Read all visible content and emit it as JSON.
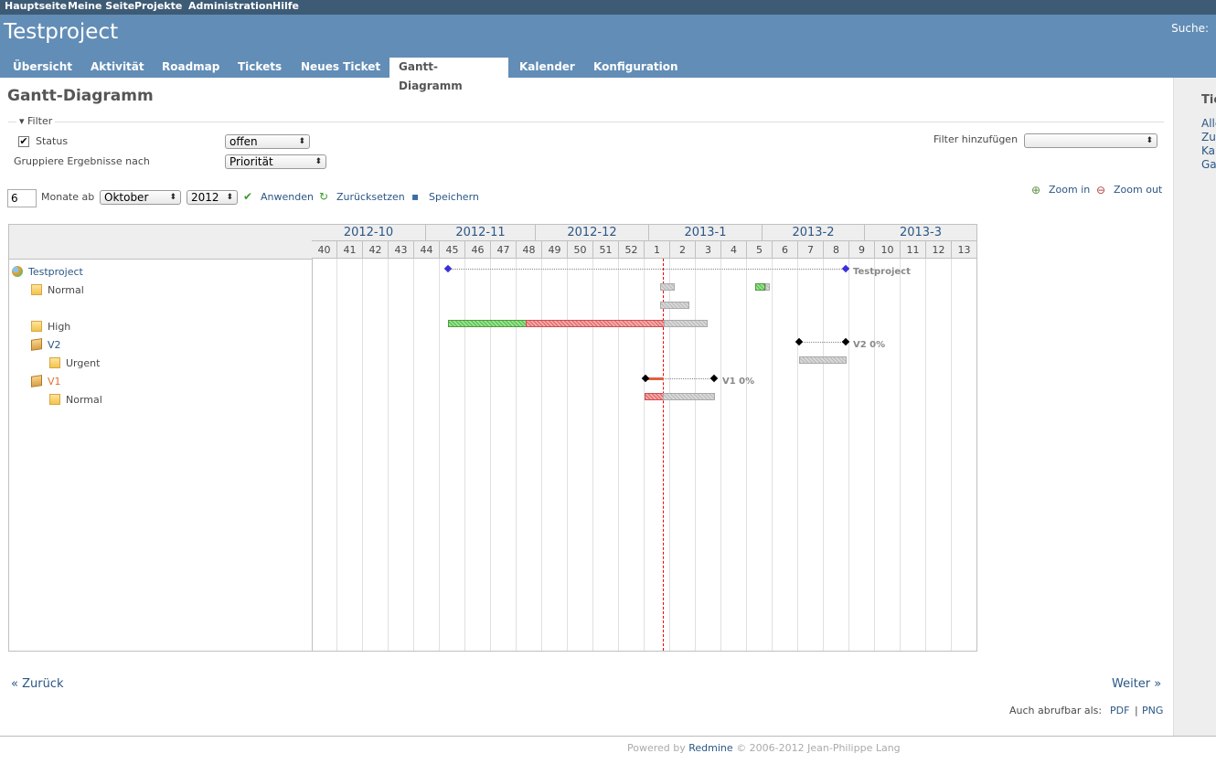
{
  "top_menu": [
    "Hauptseite",
    "Meine Seite",
    "Projekte",
    "Administration",
    "Hilfe"
  ],
  "header": {
    "project_title": "Testproject",
    "search_label": "Suche:"
  },
  "tabs": [
    "Übersicht",
    "Aktivität",
    "Roadmap",
    "Tickets",
    "Neues Ticket",
    "Gantt-Diagramm",
    "Kalender",
    "Konfiguration"
  ],
  "selected_tab": "Gantt-Diagramm",
  "page_title": "Gantt-Diagramm",
  "filter": {
    "legend": "Filter",
    "status_label": "Status",
    "status_checked": true,
    "status_value": "offen",
    "group_label": "Gruppiere Ergebnisse nach",
    "group_value": "Priorität",
    "add_filter_label": "Filter hinzufügen",
    "add_filter_value": ""
  },
  "period": {
    "months_value": "6",
    "months_label": "Monate ab",
    "month_value": "Oktober",
    "year_value": "2012",
    "apply": "Anwenden",
    "reset": "Zurücksetzen",
    "save": "Speichern",
    "zoom_in": "Zoom in",
    "zoom_out": "Zoom out"
  },
  "gantt": {
    "months": [
      "2012-10",
      "2012-11",
      "2012-12",
      "2013-1",
      "2013-2",
      "2013-3"
    ],
    "weeks": [
      "40",
      "41",
      "42",
      "43",
      "44",
      "45",
      "46",
      "47",
      "48",
      "49",
      "50",
      "51",
      "52",
      "1",
      "2",
      "3",
      "4",
      "5",
      "6",
      "7",
      "8",
      "9",
      "10",
      "11",
      "12",
      "13"
    ],
    "rows": [
      {
        "label": "Testproject",
        "type": "project",
        "link": true
      },
      {
        "label": "Normal",
        "type": "priority"
      },
      {
        "label": "High",
        "type": "priority"
      },
      {
        "label": "V2",
        "type": "version",
        "link": true
      },
      {
        "label": "Urgent",
        "type": "priority"
      },
      {
        "label": "V1",
        "type": "version",
        "link": true
      },
      {
        "label": "Normal",
        "type": "priority"
      }
    ],
    "bar_labels": {
      "project": "Testproject",
      "v2": "V2 0%",
      "v1": "V1 0%"
    }
  },
  "nav": {
    "prev": "« Zurück",
    "next": "Weiter »"
  },
  "export": {
    "label": "Auch abrufbar als:",
    "pdf": "PDF",
    "sep": "|",
    "png": "PNG"
  },
  "footer": {
    "powered_by": "Powered by",
    "redmine": "Redmine",
    "copyright": "© 2006-2012 Jean-Philippe Lang"
  },
  "sidebar": {
    "heading": "Tickets",
    "links": [
      "Alle Tickets",
      "Zusammenfassung",
      "Kalender",
      "Gantt-Diagramm"
    ]
  },
  "colors": {
    "header_bg": "#628db6",
    "top_menu_bg": "#3e5b76",
    "link": "#2a5685",
    "done": "#52b94a",
    "late": "#e06060",
    "todo": "#c0c0c0",
    "today_line": "#e00000"
  }
}
